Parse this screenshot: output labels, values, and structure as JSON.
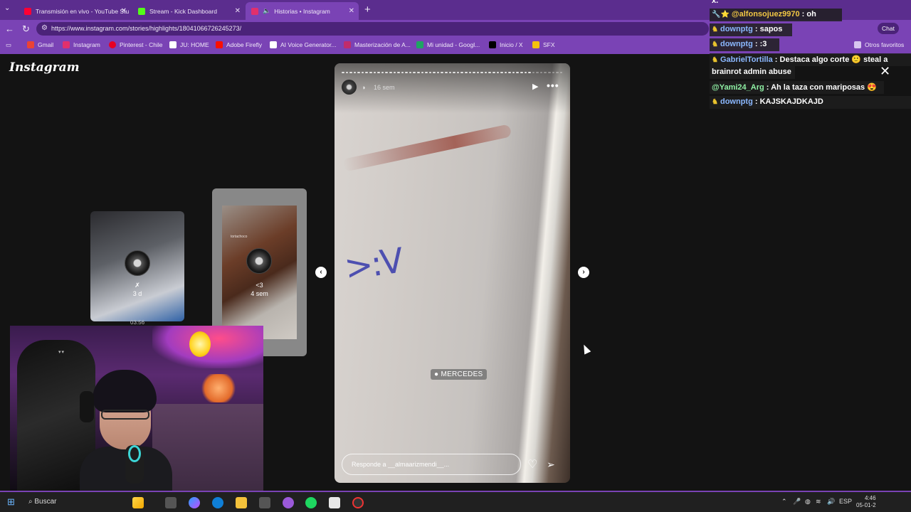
{
  "tabs": [
    {
      "label": "Transmisión en vivo - YouTube Stu",
      "color": "#ff0033"
    },
    {
      "label": "Stream - Kick Dashboard",
      "color": "#53fc18"
    },
    {
      "label": "Historias • Instagram",
      "color": "#e1306c"
    }
  ],
  "address": {
    "url": "https://www.instagram.com/stories/highlights/18041066726245273/"
  },
  "bookmarks": [
    {
      "label": "Gmail",
      "color": "#ea4335"
    },
    {
      "label": "Instagram",
      "color": "#e1306c"
    },
    {
      "label": "Pinterest - Chile",
      "color": "#e60023"
    },
    {
      "label": "JU: HOME",
      "color": "#ffffff"
    },
    {
      "label": "Adobe Firefly",
      "color": "#fa0f00"
    },
    {
      "label": "AI Voice Generator...",
      "color": "#ffffff"
    },
    {
      "label": "Masterización de A...",
      "color": "#c02c6b"
    },
    {
      "label": "Mi unidad - Googl...",
      "color": "#1fa463"
    },
    {
      "label": "Inicio / X",
      "color": "#000000"
    },
    {
      "label": "SFX",
      "color": "#f4c20d"
    }
  ],
  "other_bookmarks": "Otros favoritos",
  "instagram": {
    "logo": "Instagram",
    "card1": {
      "icon": "✗",
      "time": "3 d",
      "caption": "03:56"
    },
    "card2": {
      "icon": "<3",
      "time": "4 sem",
      "photo_caption": "tortachoco"
    },
    "story": {
      "time": "16 sem",
      "graffiti": ">:V",
      "location": "MERCEDES",
      "reply_placeholder": "Responde a __almaarizmendi__..."
    }
  },
  "chat": [
    {
      "user": "@alfonsojuez9970",
      "text": ": oh",
      "user_color": "#f2c744"
    },
    {
      "user": "downptg",
      "text": ": sapos",
      "user_color": "#8bb8ff"
    },
    {
      "user": "downptg",
      "text": ": :3",
      "user_color": "#8bb8ff"
    },
    {
      "user": "GabrielTortilla",
      "text": ": Destaca algo corte 🙂 steal a",
      "user_color": "#8bb8ff"
    },
    {
      "user": "",
      "text": "brainrot admin abuse",
      "user_color": "#ffffff"
    },
    {
      "user": "@Yami24_Arg",
      "text": ": Ah la taza con mariposas 😍",
      "user_color": "#8ff0a4"
    },
    {
      "user": "downptg",
      "text": ": KAJSKAJDKAJD",
      "user_color": "#8bb8ff"
    }
  ],
  "chat_header_fragment": "x.",
  "chat_button": "Chat",
  "taskbar": {
    "search": "Buscar",
    "lang": "ESP",
    "time": "4:46",
    "date": "05-01-2"
  }
}
